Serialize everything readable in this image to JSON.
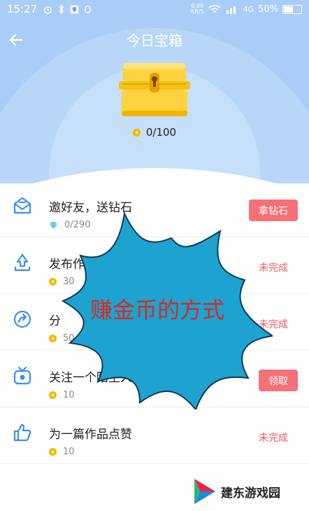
{
  "status_bar": {
    "time": "15:27",
    "net_speed_value": "0.00",
    "net_speed_unit": "KB/S",
    "network": "4G",
    "battery": "50%"
  },
  "header": {
    "title": "今日宝箱"
  },
  "chest": {
    "progress_text": "0/100"
  },
  "tasks": [
    {
      "name": "邀好友，送钻石",
      "reward": "0/290",
      "reward_icon": "diamond-icon",
      "action": "拿钻石",
      "action_type": "button",
      "icon": "mail-icon"
    },
    {
      "name": "发布作",
      "reward": "30",
      "reward_icon": "coin-icon",
      "action": "未完成",
      "action_type": "status",
      "icon": "upload-icon"
    },
    {
      "name": "分",
      "reward": "50",
      "reward_icon": "coin-icon",
      "action": "未完成",
      "action_type": "status",
      "icon": "share-icon"
    },
    {
      "name": "关注一个陌生人",
      "reward": "10",
      "reward_icon": "coin-icon",
      "action": "领取",
      "action_type": "button",
      "icon": "tv-icon"
    },
    {
      "name": "为一篇作品点赞",
      "reward": "10",
      "reward_icon": "coin-icon",
      "action": "未完成",
      "action_type": "status",
      "icon": "thumbs-up-icon"
    }
  ],
  "overlay": {
    "text": "赚金币的方式"
  },
  "watermark": {
    "text": "建东游戏园"
  },
  "colors": {
    "hero_bg": "#a9cdf6",
    "accent_button": "#f47178",
    "status_text": "#f2555d",
    "icon_blue": "#3d8ef0",
    "burst_fill": "#1ea2cf",
    "overlay_text": "#d42a23"
  }
}
